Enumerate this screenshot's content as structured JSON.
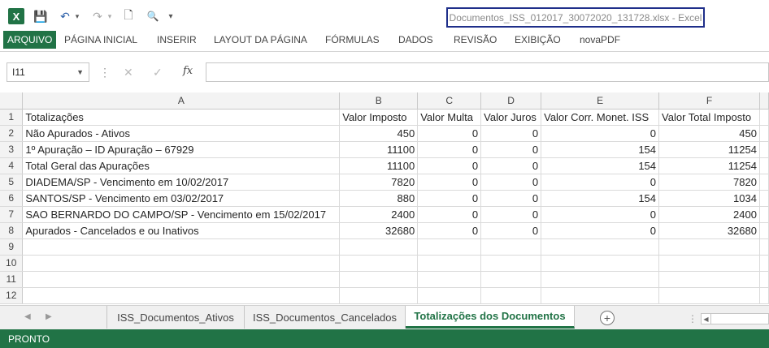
{
  "title_bar": {
    "window_title": "Documentos_ISS_012017_30072020_131728.xlsx - Excel",
    "app_logo_letter": "X",
    "save_icon": "💾",
    "undo_icon": "↶",
    "redo_icon": "↷",
    "new_icon": "🗋",
    "print_preview_icon": "🔍",
    "customize_icon": "▾"
  },
  "ribbon": {
    "tabs": [
      "ARQUIVO",
      "PÁGINA INICIAL",
      "INSERIR",
      "LAYOUT DA PÁGINA",
      "FÓRMULAS",
      "DADOS",
      "REVISÃO",
      "EXIBIÇÃO",
      "novaPDF"
    ]
  },
  "formula_bar": {
    "name_box": "I11",
    "fx_label": "fx",
    "cancel_icon": "✕",
    "enter_icon": "✓",
    "content": ""
  },
  "sheet": {
    "columns": [
      "A",
      "B",
      "C",
      "D",
      "E",
      "F"
    ],
    "rows": [
      {
        "num": "1",
        "cells": [
          "Totalizações",
          "Valor Imposto",
          "Valor Multa",
          "Valor Juros",
          "Valor Corr. Monet. ISS",
          "Valor Total Imposto"
        ]
      },
      {
        "num": "2",
        "cells": [
          "Não Apurados - Ativos",
          "450",
          "0",
          "0",
          "0",
          "450"
        ]
      },
      {
        "num": "3",
        "cells": [
          "1º Apuração – ID Apuração – 67929",
          "11100",
          "0",
          "0",
          "154",
          "11254"
        ]
      },
      {
        "num": "4",
        "cells": [
          "Total Geral das Apurações",
          "11100",
          "0",
          "0",
          "154",
          "11254"
        ]
      },
      {
        "num": "5",
        "cells": [
          "DIADEMA/SP - Vencimento em 10/02/2017",
          "7820",
          "0",
          "0",
          "0",
          "7820"
        ]
      },
      {
        "num": "6",
        "cells": [
          "SANTOS/SP - Vencimento em 03/02/2017",
          "880",
          "0",
          "0",
          "154",
          "1034"
        ]
      },
      {
        "num": "7",
        "cells": [
          "SAO BERNARDO DO CAMPO/SP - Vencimento em 15/02/2017",
          "2400",
          "0",
          "0",
          "0",
          "2400"
        ]
      },
      {
        "num": "8",
        "cells": [
          "Apurados - Cancelados e ou Inativos",
          "32680",
          "0",
          "0",
          "0",
          "32680"
        ]
      },
      {
        "num": "9",
        "cells": [
          "",
          "",
          "",
          "",
          "",
          ""
        ]
      },
      {
        "num": "10",
        "cells": [
          "",
          "",
          "",
          "",
          "",
          ""
        ]
      },
      {
        "num": "11",
        "cells": [
          "",
          "",
          "",
          "",
          "",
          ""
        ]
      },
      {
        "num": "12",
        "cells": [
          "",
          "",
          "",
          "",
          "",
          ""
        ]
      }
    ]
  },
  "sheet_tabs": {
    "tabs": [
      "ISS_Documentos_Ativos",
      "ISS_Documentos_Cancelados",
      "Totalizações dos Documentos"
    ],
    "active_index": 2,
    "add_icon": "+",
    "prev_icon": "◀",
    "next_icon": "▶"
  },
  "status_bar": {
    "status": "PRONTO"
  },
  "colors": {
    "accent": "#217346",
    "title_border": "#1f2f8a"
  }
}
